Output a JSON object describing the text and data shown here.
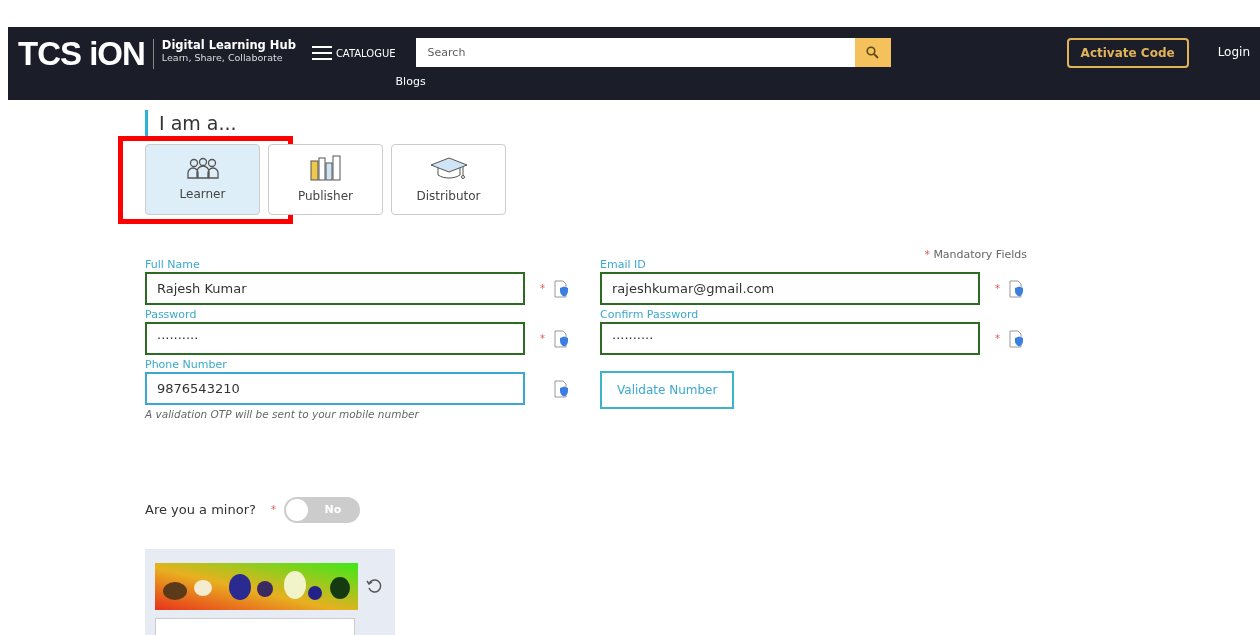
{
  "header": {
    "logo": "TCS iON",
    "hub_title": "Digital Learning Hub",
    "hub_tagline": "Learn, Share, Collaborate",
    "menu_label": "CATALOGUE",
    "search": {
      "placeholder": "Search"
    },
    "blogs_link": "Blogs",
    "activate_button": "Activate Code",
    "login_link": "Login"
  },
  "section_title": "I am a...",
  "roles": [
    {
      "kind": "learner",
      "label": "Learner",
      "selected": true,
      "highlighted": true
    },
    {
      "kind": "publisher",
      "label": "Publisher",
      "selected": false,
      "highlighted": false
    },
    {
      "kind": "distributor",
      "label": "Distributor",
      "selected": false,
      "highlighted": false
    }
  ],
  "mandatory_mark": "*",
  "mandatory_note": "Mandatory Fields",
  "fields": [
    {
      "kind": "input",
      "label": "Full Name",
      "value": "Rajesh Kumar",
      "required": true,
      "focused": false
    },
    {
      "kind": "input",
      "label": "Email ID",
      "value": "rajeshkumar@gmail.com",
      "required": true,
      "focused": false
    },
    {
      "kind": "input",
      "label": "Password",
      "value": "··········",
      "required": true,
      "focused": false
    },
    {
      "kind": "input",
      "label": "Confirm Password",
      "value": "··········",
      "required": true,
      "focused": false
    },
    {
      "kind": "input",
      "label": "Phone Number",
      "value": "9876543210",
      "required": false,
      "focused": true,
      "hint": "A validation OTP will be sent to your mobile number"
    },
    {
      "kind": "button",
      "label": "Validate Number"
    }
  ],
  "minor": {
    "label": "Are you a minor?",
    "required": true,
    "on": false,
    "state_text": "No"
  }
}
